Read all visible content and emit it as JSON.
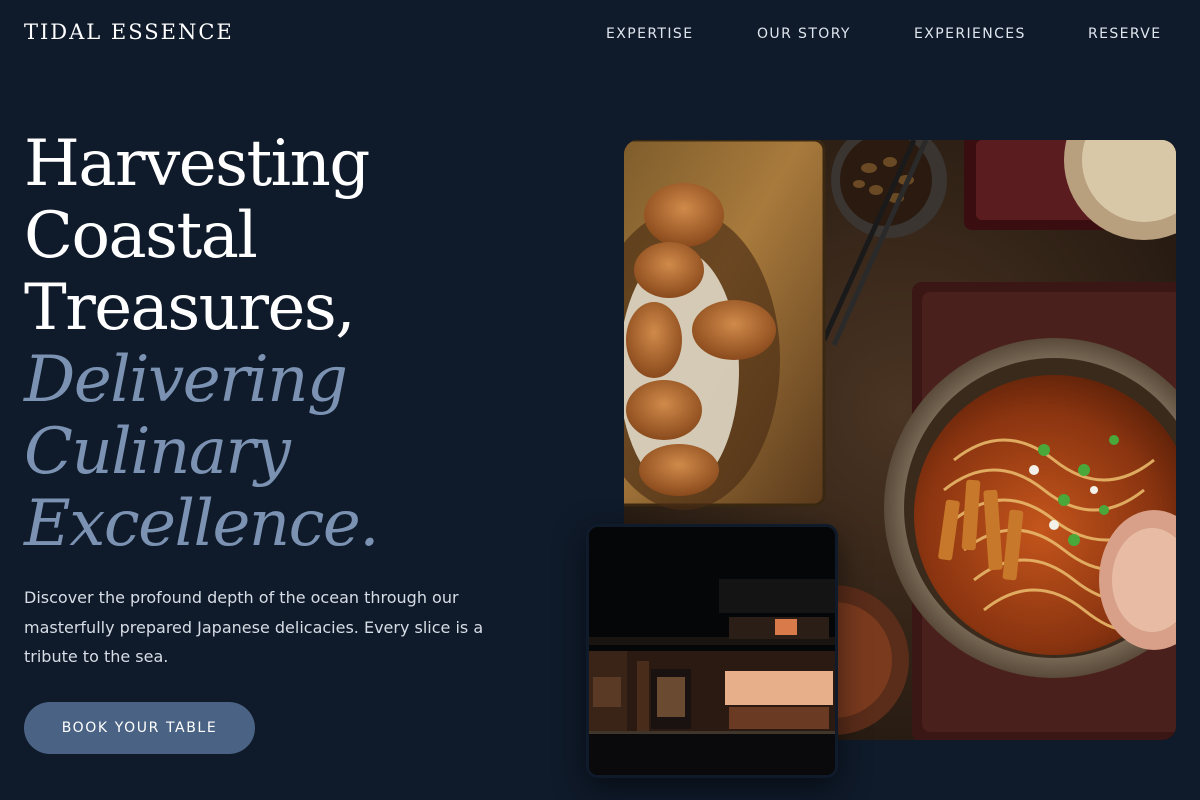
{
  "brand": {
    "name": "TIDAL ESSENCE"
  },
  "nav": {
    "items": [
      {
        "label": "EXPERTISE"
      },
      {
        "label": "OUR STORY"
      },
      {
        "label": "EXPERIENCES"
      },
      {
        "label": "RESERVE"
      }
    ]
  },
  "hero": {
    "headline_lines": [
      "Harvesting",
      "Coastal",
      "Treasures,"
    ],
    "accent_lines": [
      "Delivering",
      "Culinary",
      "Excellence."
    ],
    "description": "Discover the profound depth of the ocean through our masterfully prepared Japanese delicacies. Every slice is a tribute to the sea.",
    "cta_label": "BOOK YOUR TABLE"
  },
  "colors": {
    "background": "#0f1a2a",
    "accent_text": "#7b92b2",
    "button": "#4a6384"
  }
}
